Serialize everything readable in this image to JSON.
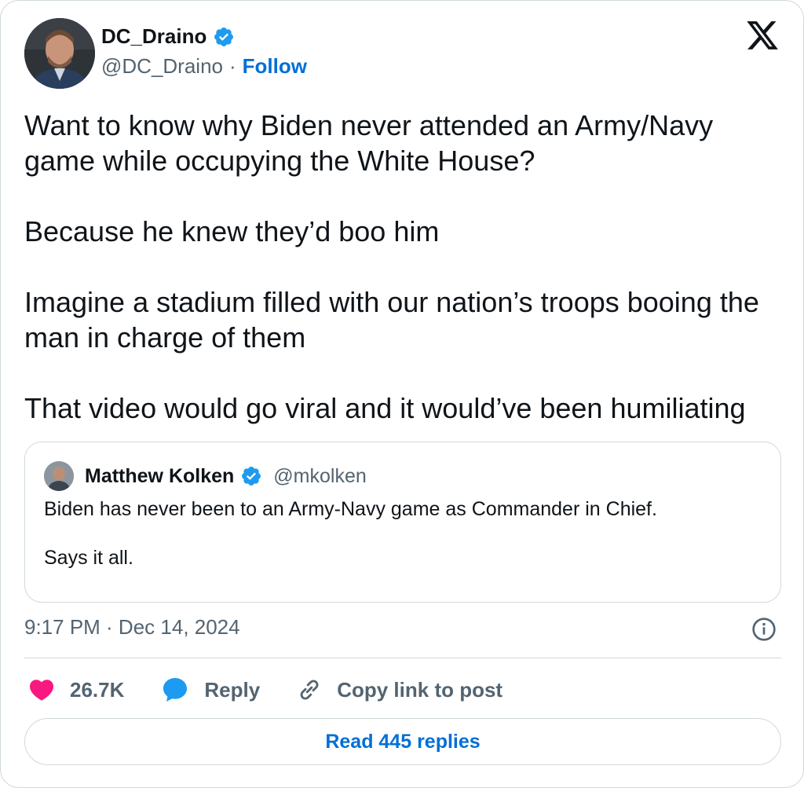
{
  "author": {
    "display_name": "DC_Draino",
    "handle": "@DC_Draino",
    "separator": "·",
    "follow_label": "Follow",
    "verified": true
  },
  "post": {
    "paragraphs": [
      "Want to know why Biden never attended an Army/Navy game while occupying the White House?",
      "Because he knew they’d boo him",
      "Imagine a stadium filled with our nation’s troops booing the man in charge of them",
      "That video would go viral and it would’ve been humiliating"
    ]
  },
  "quoted": {
    "display_name": "Matthew Kolken",
    "handle": "@mkolken",
    "verified": true,
    "paragraphs": [
      "Biden has never been to an Army-Navy game as Commander in Chief.",
      "Says it all."
    ]
  },
  "meta": {
    "timestamp": "9:17 PM · Dec 14, 2024"
  },
  "actions": {
    "likes": "26.7K",
    "reply_label": "Reply",
    "copy_label": "Copy link to post"
  },
  "read_replies_label": "Read 445 replies",
  "colors": {
    "accent": "#006fd6",
    "verified": "#1d9bf0",
    "like": "#f91880",
    "muted": "#536471",
    "border": "#cfd9de"
  },
  "icons": [
    "verified-badge-icon",
    "x-logo-icon",
    "info-icon",
    "heart-icon",
    "reply-bubble-icon",
    "link-icon"
  ]
}
